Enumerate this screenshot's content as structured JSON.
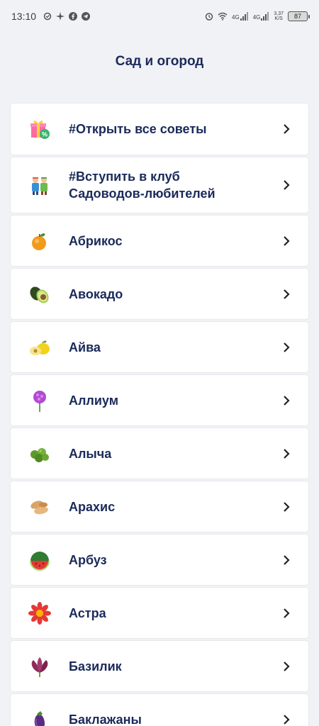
{
  "status_bar": {
    "time": "13:10",
    "net1": "4G",
    "net2": "4G",
    "speed_top": "3,37",
    "speed_bottom": "K/S",
    "battery": "87"
  },
  "header": {
    "title": "Сад и огород"
  },
  "items": [
    {
      "label": "#Открыть все советы",
      "icon": "gift-percent-icon"
    },
    {
      "label": "#Вступить в клуб Садоводов-любителей",
      "icon": "gardeners-icon"
    },
    {
      "label": "Абрикос",
      "icon": "apricot-icon"
    },
    {
      "label": "Авокадо",
      "icon": "avocado-icon"
    },
    {
      "label": "Айва",
      "icon": "quince-icon"
    },
    {
      "label": "Аллиум",
      "icon": "allium-icon"
    },
    {
      "label": "Алыча",
      "icon": "cherry-plum-icon"
    },
    {
      "label": "Арахис",
      "icon": "peanut-icon"
    },
    {
      "label": "Арбуз",
      "icon": "watermelon-icon"
    },
    {
      "label": "Астра",
      "icon": "aster-icon"
    },
    {
      "label": "Базилик",
      "icon": "basil-icon"
    },
    {
      "label": "Баклажаны",
      "icon": "eggplant-icon"
    }
  ]
}
